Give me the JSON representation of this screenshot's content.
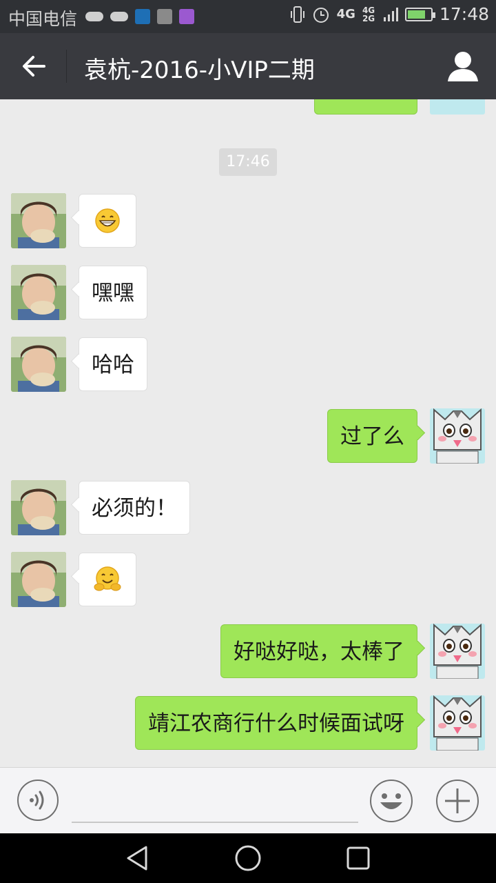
{
  "status_bar": {
    "carrier": "中国电信",
    "network_primary": "4G",
    "network_secondary": "4G 2G",
    "time": "17:48",
    "battery_level": 0.7
  },
  "header": {
    "title": "袁杭-2016-小VIP二期",
    "back_icon": "arrow-left-icon",
    "profile_icon": "person-icon"
  },
  "chat": {
    "timestamp": "17:46",
    "messages": [
      {
        "side": "in",
        "type": "emoji",
        "emoji": "grin-emoji"
      },
      {
        "side": "in",
        "type": "text",
        "text": "嘿嘿"
      },
      {
        "side": "in",
        "type": "text",
        "text": "哈哈"
      },
      {
        "side": "out",
        "type": "text",
        "text": "过了么"
      },
      {
        "side": "in",
        "type": "text",
        "text": "必须的！"
      },
      {
        "side": "in",
        "type": "emoji",
        "emoji": "hug-emoji"
      },
      {
        "side": "out",
        "type": "text",
        "text": "好哒好哒，太棒了"
      },
      {
        "side": "out",
        "type": "text",
        "text": "靖江农商行什么时候面试呀"
      }
    ]
  },
  "input_bar": {
    "voice_icon": "voice-icon",
    "emoji_icon": "smiley-icon",
    "plus_icon": "plus-icon",
    "value": ""
  },
  "colors": {
    "title_bar": "#393a3f",
    "chat_background": "#ebebeb",
    "outgoing_bubble": "#9fe658",
    "incoming_bubble": "#ffffff"
  }
}
